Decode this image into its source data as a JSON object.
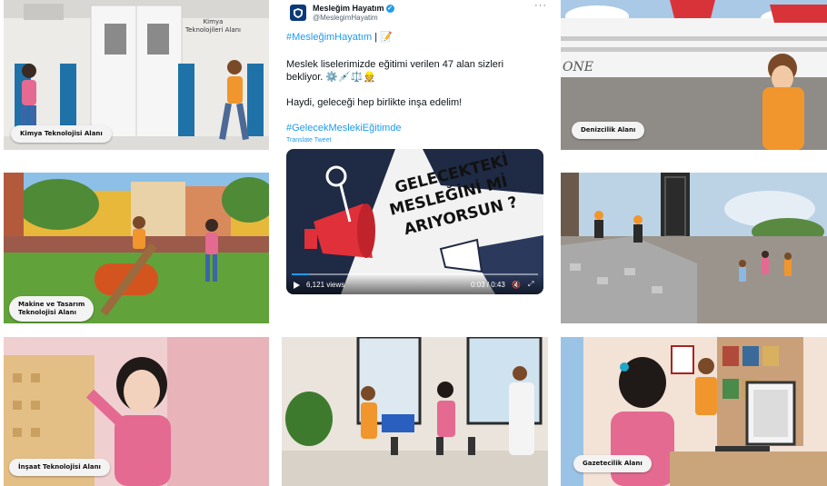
{
  "tiles": {
    "chemistry": "Kimya Teknolojisi Alanı",
    "chemistry_sign": "Kimya\nTeknolojileri Alanı",
    "maritime": "Denizcilik Alanı",
    "ship_text": "ONE",
    "machine": "Makine ve Tasarım\nTeknolojisi Alanı",
    "construction": "İnşaat Teknolojisi Alanı",
    "journalism": "Gazetecilik Alanı"
  },
  "tweet": {
    "account_name": "Mesleğim Hayatım",
    "handle": "@MeslegimHayatim",
    "line1_hashtag": "#MesleğimHayatım",
    "line1_suffix": " | 📝",
    "body1": "Meslek liselerimizde eğitimi verilen 47 alan sizleri",
    "body2": "bekliyor. ⚙️💉⚖️👷",
    "body3": "Haydi, geleceği hep birlikte inşa edelim!",
    "hashtag2": "#GelecekMeslekiEğitimde",
    "translate": "Translate Tweet",
    "video_title_1": "GELECEKTEKİ",
    "video_title_2": "MESLEĞİNİ Mİ",
    "video_title_3": "ARIYORSUN ?",
    "views": "6,121 views",
    "time": "0:03 / 0:43",
    "progress": 0.07
  },
  "colors": {
    "twitter_blue": "#1d9bf0",
    "megaphone_red": "#e0303a",
    "navy": "#1f2a44"
  }
}
